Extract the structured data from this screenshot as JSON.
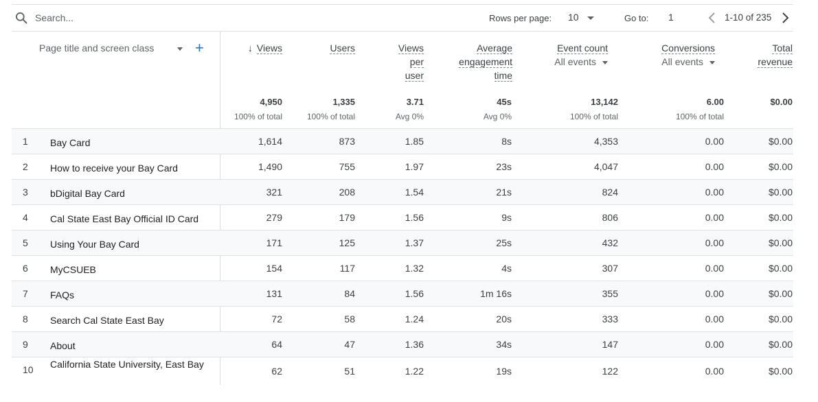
{
  "toolbar": {
    "search_placeholder": "Search...",
    "rows_per_page_label": "Rows per page:",
    "rows_per_page_value": "10",
    "goto_label": "Go to:",
    "goto_value": "1",
    "range_text": "1-10 of 235"
  },
  "header": {
    "dimension": "Page title and screen class",
    "add_symbol": "+",
    "views": "Views",
    "users": "Users",
    "views_per_user": [
      "Views",
      "per",
      "user"
    ],
    "avg_engagement": [
      "Average",
      "engagement",
      "time"
    ],
    "event_count": "Event count",
    "event_count_sub": "All events",
    "conversions": "Conversions",
    "conversions_sub": "All events",
    "total_revenue": [
      "Total",
      "revenue"
    ],
    "sort_arrow": "↓"
  },
  "totals": {
    "views": "4,950",
    "views_sub": "100% of total",
    "users": "1,335",
    "users_sub": "100% of total",
    "vpu": "3.71",
    "vpu_sub": "Avg 0%",
    "aet": "45s",
    "aet_sub": "Avg 0%",
    "events": "13,142",
    "events_sub": "100% of total",
    "conversions": "6.00",
    "conversions_sub": "100% of total",
    "revenue": "$0.00"
  },
  "rows": [
    {
      "idx": "1",
      "title": "Bay Card",
      "views": "1,614",
      "users": "873",
      "vpu": "1.85",
      "aet": "8s",
      "events": "4,353",
      "conv": "0.00",
      "rev": "$0.00"
    },
    {
      "idx": "2",
      "title": "How to receive your Bay Card",
      "views": "1,490",
      "users": "755",
      "vpu": "1.97",
      "aet": "23s",
      "events": "4,047",
      "conv": "0.00",
      "rev": "$0.00"
    },
    {
      "idx": "3",
      "title": "bDigital Bay Card",
      "views": "321",
      "users": "208",
      "vpu": "1.54",
      "aet": "21s",
      "events": "824",
      "conv": "0.00",
      "rev": "$0.00"
    },
    {
      "idx": "4",
      "title": "Cal State East Bay Official ID Card",
      "views": "279",
      "users": "179",
      "vpu": "1.56",
      "aet": "9s",
      "events": "806",
      "conv": "0.00",
      "rev": "$0.00"
    },
    {
      "idx": "5",
      "title": "Using Your Bay Card",
      "views": "171",
      "users": "125",
      "vpu": "1.37",
      "aet": "25s",
      "events": "432",
      "conv": "0.00",
      "rev": "$0.00"
    },
    {
      "idx": "6",
      "title": "MyCSUEB",
      "views": "154",
      "users": "117",
      "vpu": "1.32",
      "aet": "4s",
      "events": "307",
      "conv": "0.00",
      "rev": "$0.00"
    },
    {
      "idx": "7",
      "title": "FAQs",
      "views": "131",
      "users": "84",
      "vpu": "1.56",
      "aet": "1m 16s",
      "events": "355",
      "conv": "0.00",
      "rev": "$0.00"
    },
    {
      "idx": "8",
      "title": "Search Cal State East Bay",
      "views": "72",
      "users": "58",
      "vpu": "1.24",
      "aet": "20s",
      "events": "333",
      "conv": "0.00",
      "rev": "$0.00"
    },
    {
      "idx": "9",
      "title": "About",
      "views": "64",
      "users": "47",
      "vpu": "1.36",
      "aet": "34s",
      "events": "147",
      "conv": "0.00",
      "rev": "$0.00"
    },
    {
      "idx": "10",
      "title": "California State University, East Bay",
      "views": "62",
      "users": "51",
      "vpu": "1.22",
      "aet": "19s",
      "events": "122",
      "conv": "0.00",
      "rev": "$0.00"
    }
  ]
}
